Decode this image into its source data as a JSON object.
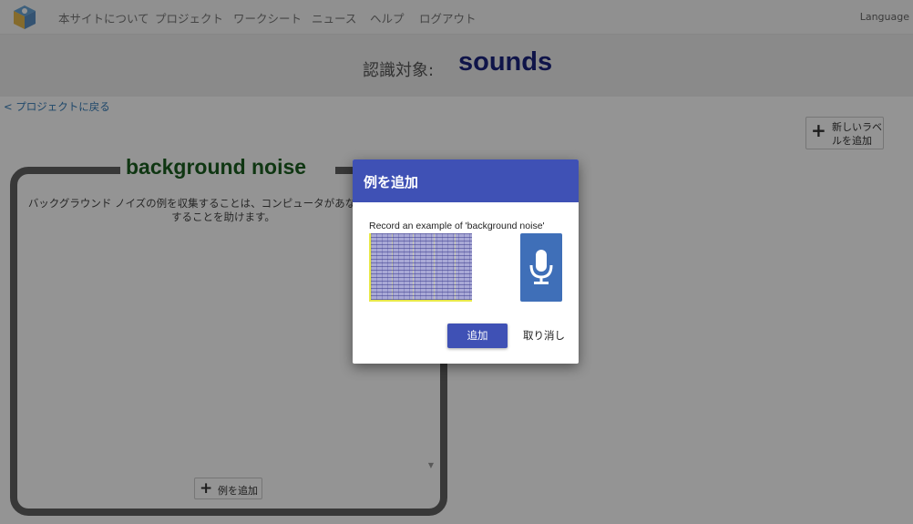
{
  "nav": {
    "items": [
      "本サイトについて",
      "プロジェクト",
      "ワークシート",
      "ニュース",
      "ヘルプ",
      "ログアウト"
    ],
    "language": "Language"
  },
  "header": {
    "label": "認識対象:",
    "project": "sounds"
  },
  "back_link": "< プロジェクトに戻る",
  "add_label_button": "新しいラベルを追加",
  "card": {
    "title": "background noise",
    "description": "バックグラウンド ノイズの例を収集することは、コンピュータがあなたの声を認識することを助けます。",
    "add_example_button": "例を追加"
  },
  "dialog": {
    "title": "例を追加",
    "prompt": "Record an example of 'background noise'",
    "add_button": "追加",
    "cancel_button": "取り消し"
  },
  "colors": {
    "accent": "#3f51b5",
    "project_title": "#1a237e",
    "label_title": "#1b5e20",
    "mic_button": "#3f6fb8"
  }
}
